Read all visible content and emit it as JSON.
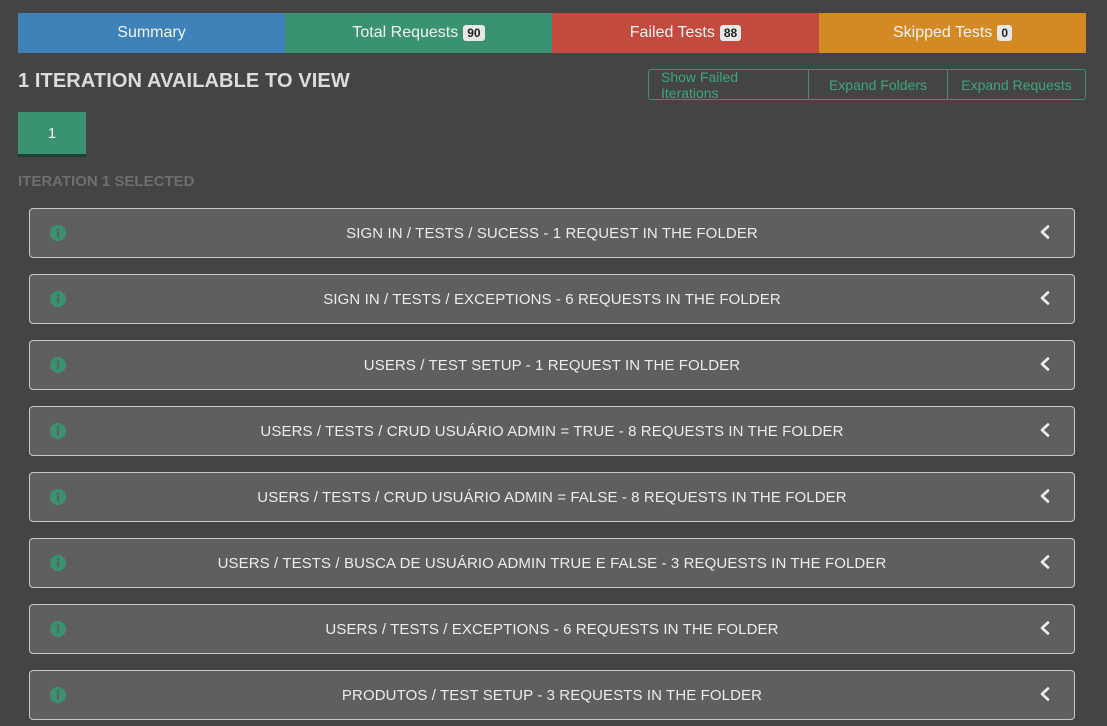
{
  "tabs": [
    {
      "label": "Summary"
    },
    {
      "label": "Total Requests",
      "count": "90"
    },
    {
      "label": "Failed Tests",
      "count": "88"
    },
    {
      "label": "Skipped Tests",
      "count": "0"
    }
  ],
  "heading": "1 ITERATION AVAILABLE TO VIEW",
  "actions": {
    "show_failed": "Show Failed Iterations",
    "expand_folders": "Expand Folders",
    "expand_requests": "Expand Requests"
  },
  "iteration": {
    "button_label": "1",
    "selected_text": "ITERATION 1 SELECTED"
  },
  "folders": [
    {
      "title": "SIGN IN / TESTS / SUCESS - 1 REQUEST IN THE FOLDER"
    },
    {
      "title": "SIGN IN / TESTS / EXCEPTIONS - 6 REQUESTS IN THE FOLDER"
    },
    {
      "title": "USERS / TEST SETUP - 1 REQUEST IN THE FOLDER"
    },
    {
      "title": "USERS / TESTS / CRUD USUÁRIO ADMIN = TRUE - 8 REQUESTS IN THE FOLDER"
    },
    {
      "title": "USERS / TESTS / CRUD USUÁRIO ADMIN = FALSE - 8 REQUESTS IN THE FOLDER"
    },
    {
      "title": "USERS / TESTS / BUSCA DE USUÁRIO ADMIN TRUE E FALSE - 3 REQUESTS IN THE FOLDER"
    },
    {
      "title": "USERS / TESTS / EXCEPTIONS - 6 REQUESTS IN THE FOLDER"
    },
    {
      "title": "PRODUTOS / TEST SETUP - 3 REQUESTS IN THE FOLDER"
    }
  ],
  "colors": {
    "summary": "#3f82b9",
    "success": "#3a9370",
    "danger": "#c34a3f",
    "warning": "#d38924",
    "background": "#444444",
    "folder_bg": "#5f5f61"
  },
  "icons": {
    "folder_status": "info-circle-icon",
    "folder_toggle": "chevron-left-icon"
  }
}
